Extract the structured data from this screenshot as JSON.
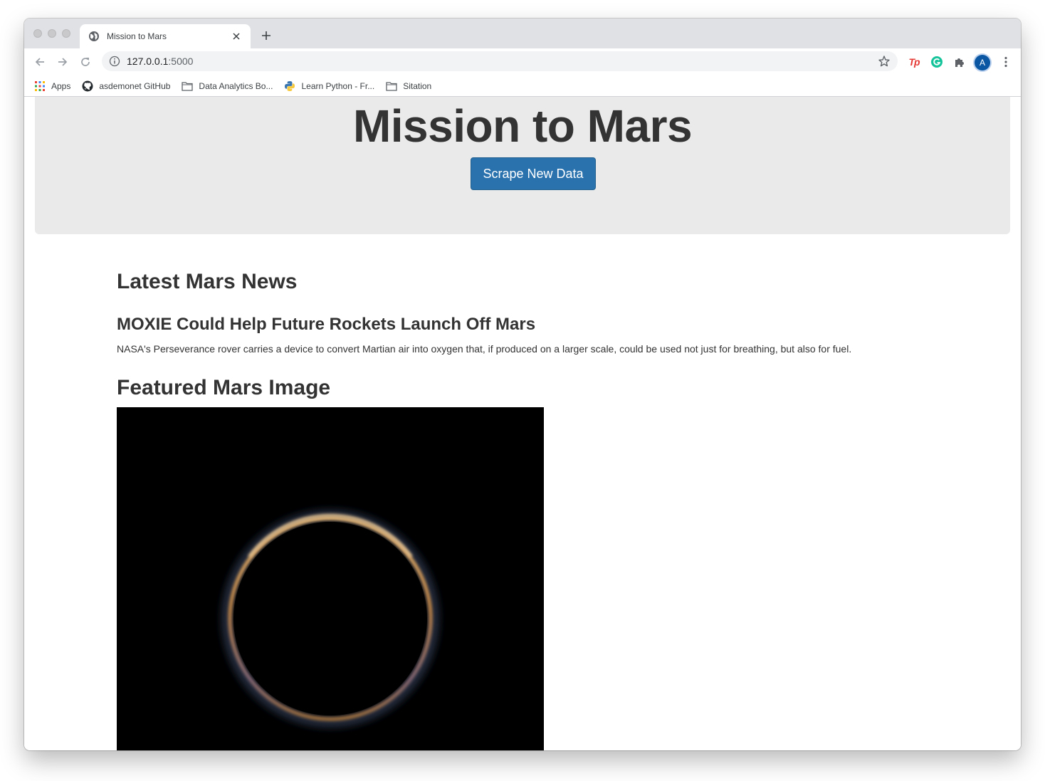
{
  "browser": {
    "tab_title": "Mission to Mars",
    "url_host": "127.0.0.1",
    "url_port": ":5000",
    "avatar_initial": "A",
    "extensions": {
      "tp_label": "Tp"
    },
    "bookmarks": [
      {
        "label": "Apps",
        "icon": "apps-grid-icon"
      },
      {
        "label": "asdemonet GitHub",
        "icon": "github-icon"
      },
      {
        "label": "Data Analytics Bo...",
        "icon": "folder-icon"
      },
      {
        "label": "Learn Python - Fr...",
        "icon": "python-icon"
      },
      {
        "label": "Sitation",
        "icon": "folder-icon"
      }
    ]
  },
  "page": {
    "title": "Mission to Mars",
    "scrape_button_label": "Scrape New Data",
    "news_heading": "Latest Mars News",
    "news_title": "MOXIE Could Help Future Rockets Launch Off Mars",
    "news_teaser": "NASA's Perseverance rover carries a device to convert Martian air into oxygen that, if produced on a larger scale, could be used not just for breathing, but also for fuel.",
    "featured_heading": "Featured Mars Image"
  },
  "colors": {
    "jumbotron_bg": "#eaeaea",
    "button_primary": "#2a72ad",
    "text": "#333333"
  }
}
